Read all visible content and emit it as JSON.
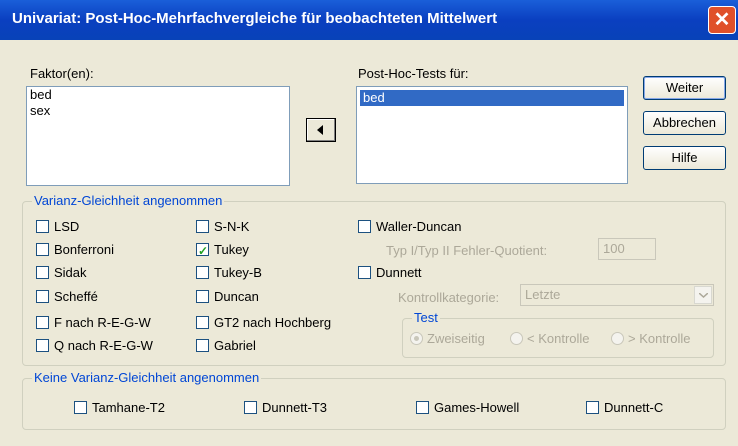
{
  "window": {
    "title": "Univariat: Post-Hoc-Mehrfachvergleiche für beobachteten Mittelwert",
    "close_label": "✕"
  },
  "factors": {
    "label": "Faktor(en):",
    "items": [
      "bed",
      "sex"
    ]
  },
  "posthoc": {
    "label": "Post-Hoc-Tests für:",
    "items": [
      "bed"
    ],
    "selected": "bed"
  },
  "buttons": {
    "weiter": "Weiter",
    "abbrechen": "Abbrechen",
    "hilfe": "Hilfe"
  },
  "equal_variance": {
    "legend": "Varianz-Gleichheit angenommen",
    "col1": [
      {
        "label": "LSD",
        "checked": false
      },
      {
        "label": "Bonferroni",
        "checked": false
      },
      {
        "label": "Sidak",
        "checked": false
      },
      {
        "label": "Scheffé",
        "checked": false
      },
      {
        "label": "F nach R-E-G-W",
        "checked": false
      },
      {
        "label": "Q nach R-E-G-W",
        "checked": false
      }
    ],
    "col2": [
      {
        "label": "S-N-K",
        "checked": false
      },
      {
        "label": "Tukey",
        "checked": true
      },
      {
        "label": "Tukey-B",
        "checked": false
      },
      {
        "label": "Duncan",
        "checked": false
      },
      {
        "label": "GT2 nach Hochberg",
        "checked": false
      },
      {
        "label": "Gabriel",
        "checked": false
      }
    ],
    "waller": {
      "label": "Waller-Duncan",
      "checked": false
    },
    "error_ratio_label": "Typ I/Typ II Fehler-Quotient:",
    "error_ratio_value": "100",
    "dunnett": {
      "label": "Dunnett",
      "checked": false
    },
    "control_label": "Kontrollkategorie:",
    "control_value": "Letzte",
    "test": {
      "legend": "Test",
      "options": [
        "Zweiseitig",
        "< Kontrolle",
        "> Kontrolle"
      ],
      "selected": "Zweiseitig"
    }
  },
  "unequal_variance": {
    "legend": "Keine Varianz-Gleichheit angenommen",
    "items": [
      {
        "label": "Tamhane-T2",
        "checked": false
      },
      {
        "label": "Dunnett-T3",
        "checked": false
      },
      {
        "label": "Games-Howell",
        "checked": false
      },
      {
        "label": "Dunnett-C",
        "checked": false
      }
    ]
  }
}
